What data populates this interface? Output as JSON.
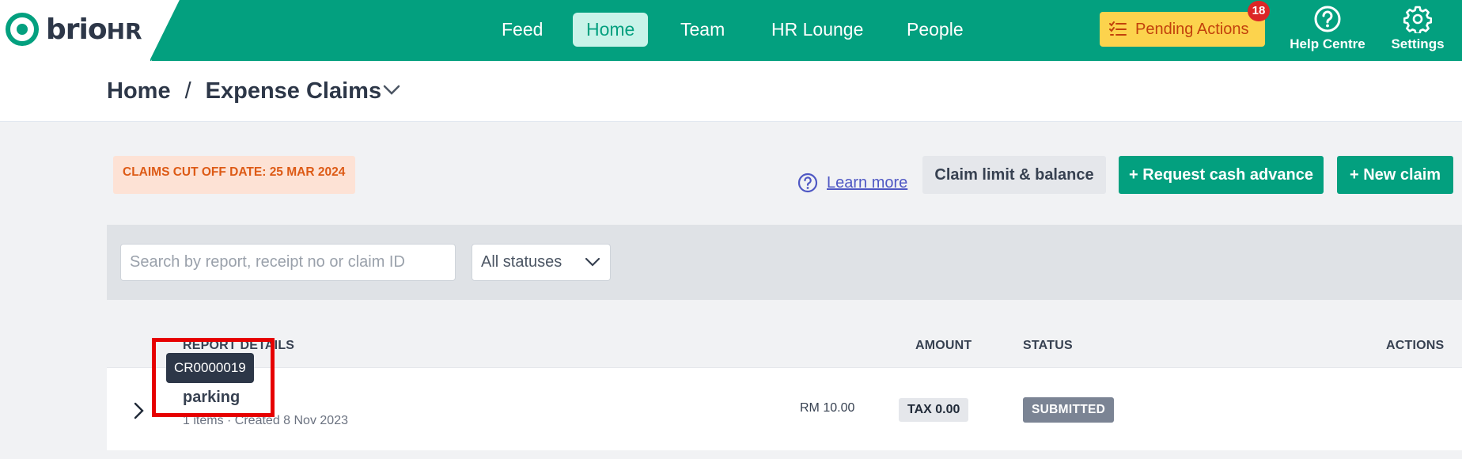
{
  "brand": {
    "logo_text": "brio",
    "logo_suffix": "HR"
  },
  "nav": {
    "items": [
      {
        "label": "Feed",
        "active": false
      },
      {
        "label": "Home",
        "active": true
      },
      {
        "label": "Team",
        "active": false
      },
      {
        "label": "HR Lounge",
        "active": false
      },
      {
        "label": "People",
        "active": false
      }
    ],
    "pending_label": "Pending Actions",
    "pending_count": "18",
    "help_label": "Help Centre",
    "settings_label": "Settings"
  },
  "breadcrumb": {
    "root": "Home",
    "separator": "/",
    "current": "Expense Claims"
  },
  "actions": {
    "cutoff": "CLAIMS CUT OFF DATE: 25 MAR 2024",
    "learn_more": "Learn more",
    "claim_limit": "Claim limit & balance",
    "cash_advance": "+ Request cash advance",
    "new_claim": "+ New claim"
  },
  "filters": {
    "search_placeholder": "Search by report, receipt no or claim ID",
    "status_value": "All statuses"
  },
  "table": {
    "headers": {
      "details": "REPORT DETAILS",
      "amount": "AMOUNT",
      "status": "STATUS",
      "actions": "ACTIONS"
    },
    "rows": [
      {
        "claim_id": "CR0000019",
        "title": "parking",
        "subtitle": "1 items · Created 8 Nov 2023",
        "amount": "RM 10.00",
        "tax": "TAX 0.00",
        "status": "SUBMITTED"
      }
    ]
  },
  "colors": {
    "brand_green": "#03a07f",
    "pending_yellow": "#fcd34d",
    "status_grey": "#7b8494",
    "highlight_red": "#e60000"
  }
}
